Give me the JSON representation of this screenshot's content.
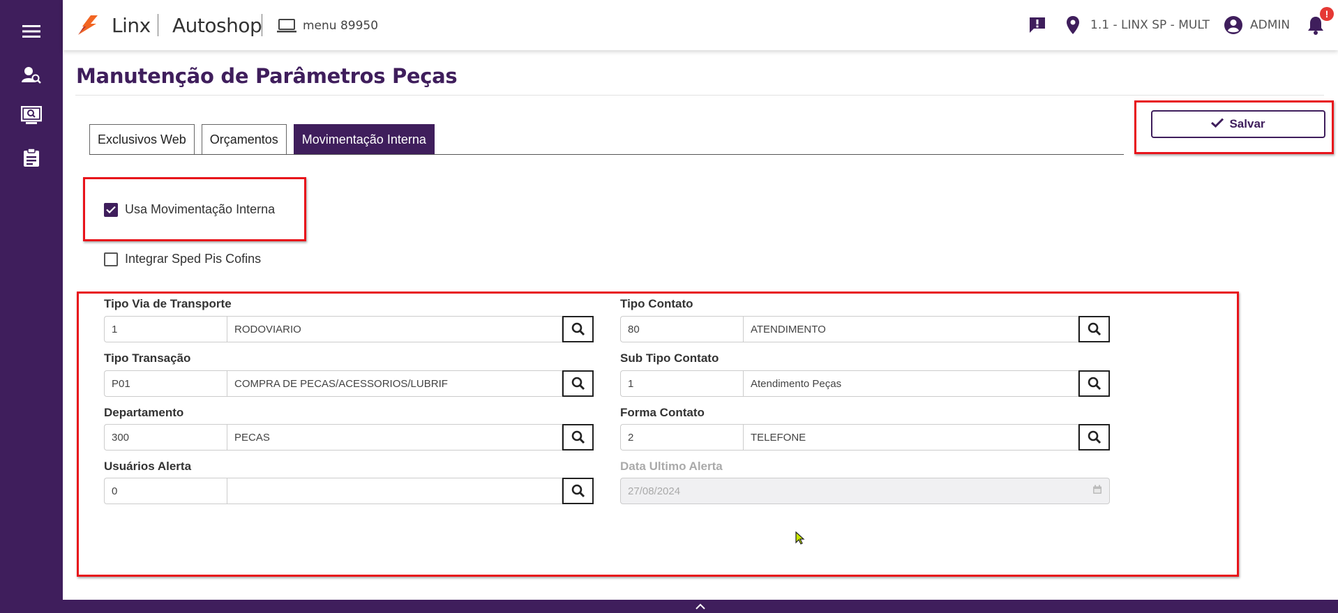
{
  "sidebar": {
    "items": [
      {
        "icon": "menu-icon"
      },
      {
        "icon": "user-search-icon"
      },
      {
        "icon": "monitor-search-icon"
      },
      {
        "icon": "clipboard-icon"
      }
    ]
  },
  "header": {
    "brand": "Linx",
    "product": "Autoshop",
    "menu_code": "menu 89950",
    "location": "1.1 - LINX SP - MULT",
    "user": "ADMIN",
    "notification_badge": "!"
  },
  "page": {
    "title": "Manutenção de Parâmetros Peças",
    "save_label": "Salvar"
  },
  "tabs": [
    {
      "label": "Exclusivos Web",
      "active": false
    },
    {
      "label": "Orçamentos",
      "active": false
    },
    {
      "label": "Movimentação Interna",
      "active": true
    }
  ],
  "checkboxes": {
    "usa_movimentacao": {
      "label": "Usa Movimentação Interna",
      "checked": true
    },
    "integrar_sped": {
      "label": "Integrar Sped Pis Cofins",
      "checked": false
    }
  },
  "fields": {
    "tipo_via": {
      "label": "Tipo Via de Transporte",
      "code": "1",
      "desc": "RODOVIARIO"
    },
    "tipo_transacao": {
      "label": "Tipo Transação",
      "code": "P01",
      "desc": "COMPRA DE PECAS/ACESSORIOS/LUBRIF"
    },
    "departamento": {
      "label": "Departamento",
      "code": "300",
      "desc": "PECAS"
    },
    "usuarios_alerta": {
      "label": "Usuários Alerta",
      "code": "0",
      "desc": ""
    },
    "tipo_contato": {
      "label": "Tipo Contato",
      "code": "80",
      "desc": "ATENDIMENTO"
    },
    "sub_tipo_contato": {
      "label": "Sub Tipo Contato",
      "code": "1",
      "desc": "Atendimento Peças"
    },
    "forma_contato": {
      "label": "Forma Contato",
      "code": "2",
      "desc": "TELEFONE"
    },
    "data_ultimo_alerta": {
      "label": "Data Ultimo Alerta",
      "value": "27/08/2024"
    }
  },
  "colors": {
    "brand_purple": "#3f1e5c",
    "highlight_red": "#e8141b",
    "logo_orange": "#f26522"
  }
}
